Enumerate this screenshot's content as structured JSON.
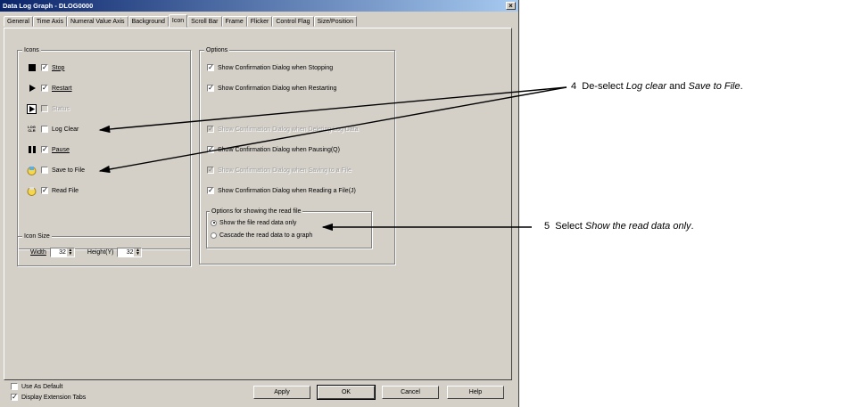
{
  "window": {
    "title": "Data Log Graph - DLOG0000"
  },
  "tabs": [
    "General",
    "Time Axis",
    "Numeral Value Axis",
    "Background",
    "Icon",
    "Scroll Bar",
    "Frame",
    "Flicker",
    "Control Flag",
    "Size/Position"
  ],
  "active_tab": "Icon",
  "icons_group": {
    "label": "Icons",
    "items": [
      {
        "icon": "stop-icon",
        "label": "Stop",
        "checked": true,
        "enabled": true
      },
      {
        "icon": "restart-icon",
        "label": "Restart",
        "checked": true,
        "enabled": true
      },
      {
        "icon": "status-icon",
        "label": "Status",
        "checked": false,
        "enabled": false
      },
      {
        "icon": "log-clear-icon",
        "label": "Log Clear",
        "checked": false,
        "enabled": true
      },
      {
        "icon": "pause-icon",
        "label": "Pause",
        "checked": true,
        "enabled": true
      },
      {
        "icon": "save-to-file-icon",
        "label": "Save to File",
        "checked": false,
        "enabled": true
      },
      {
        "icon": "read-file-icon",
        "label": "Read File",
        "checked": true,
        "enabled": true
      }
    ],
    "log_clear_glyph": "LOG\nCLR"
  },
  "icon_size": {
    "label": "Icon Size",
    "width_label": "Width",
    "width_value": "32",
    "height_label": "Height(Y)",
    "height_value": "32"
  },
  "options_group": {
    "label": "Options",
    "items": [
      {
        "label": "Show Confirmation Dialog when Stopping",
        "checked": true,
        "enabled": true
      },
      {
        "label": "Show Confirmation Dialog when Restarting",
        "checked": true,
        "enabled": true
      },
      {
        "label": "Show Confirmation Dialog when Deleting Log Data",
        "checked": true,
        "enabled": false
      },
      {
        "label": "Show Confirmation Dialog when Pausing(Q)",
        "checked": true,
        "enabled": true
      },
      {
        "label": "Show Confirmation Dialog when Saving to a File",
        "checked": true,
        "enabled": false
      },
      {
        "label": "Show Confirmation Dialog when Reading a File(J)",
        "checked": true,
        "enabled": true
      }
    ],
    "read_file": {
      "label": "Options for showing the read file",
      "options": [
        {
          "label": "Show the file read data only",
          "selected": true
        },
        {
          "label": "Cascade the read data to a graph",
          "selected": false
        }
      ]
    }
  },
  "footer": {
    "use_as_default": {
      "label": "Use As Default",
      "checked": false
    },
    "display_extension_tabs": {
      "label": "Display Extension Tabs",
      "checked": true
    },
    "buttons": {
      "apply": "Apply",
      "ok": "OK",
      "cancel": "Cancel",
      "help": "Help"
    }
  },
  "annotations": [
    {
      "number": "4",
      "text_parts": [
        "De-select ",
        "Log clear",
        " and ",
        "Save to File",
        "."
      ]
    },
    {
      "number": "5",
      "text_parts": [
        "Select ",
        "Show the read data only",
        "."
      ]
    }
  ],
  "colors": {
    "dialog_bg": "#d4d0c8",
    "title_start": "#0a246a",
    "title_end": "#a6caf0",
    "icon_yellow": "#f6d64a",
    "icon_blue": "#5ab0e6"
  }
}
